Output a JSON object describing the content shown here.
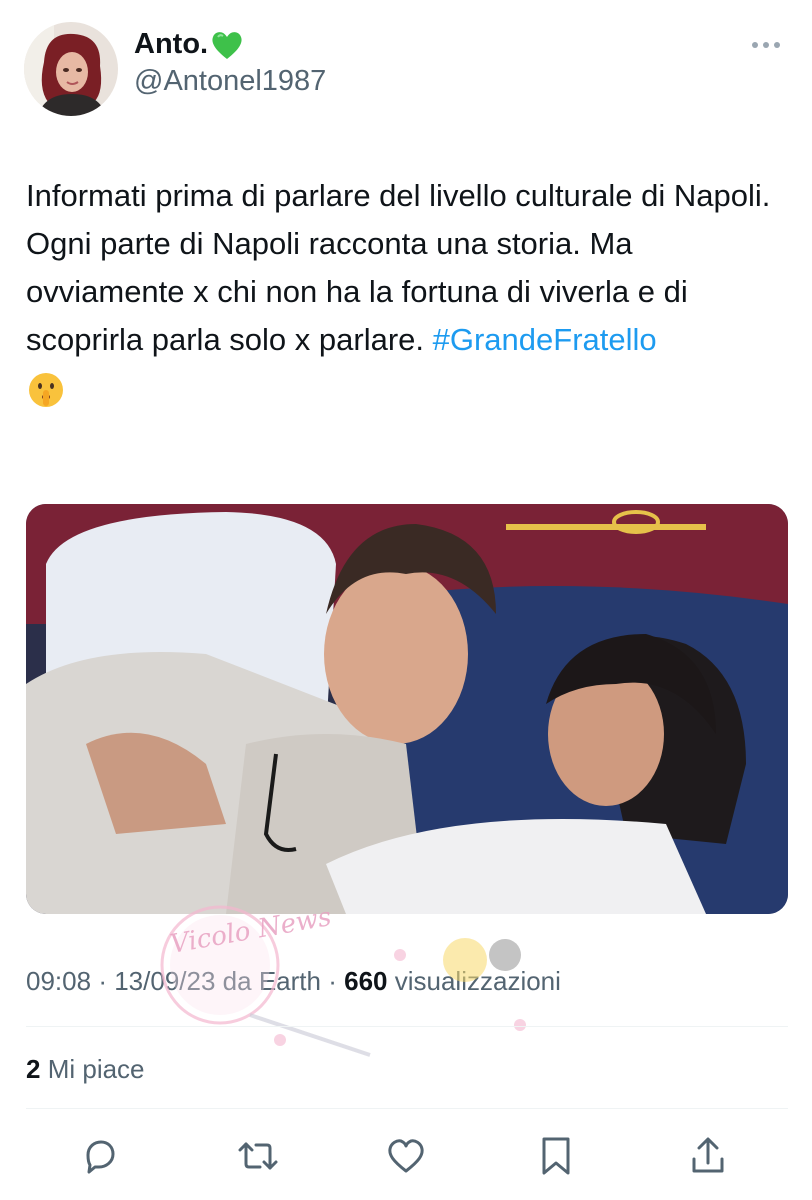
{
  "author": {
    "display_name": "Anto.",
    "badge_emoji": "green-heart",
    "handle": "@Antonel1987"
  },
  "tweet": {
    "line1": "Informati prima di parlare del livello culturale di Napoli.",
    "line2": "Ogni parte di Napoli racconta una storia. Ma ovviamente x chi non ha la fortuna di viverla e di scoprirla parla solo x parlare. ",
    "hashtag": "#GrandeFratello",
    "trailing_emoji": "shushing-face"
  },
  "meta": {
    "time": "09:08",
    "date": "13/09/23",
    "source": "da Earth",
    "views_count": "660",
    "views_label": "visualizzazioni",
    "separator": "·"
  },
  "engagement": {
    "likes_count": "2",
    "likes_label": "Mi piace"
  },
  "colors": {
    "link": "#1d9bf0",
    "secondary_text": "#536471",
    "primary_text": "#0f1419",
    "divider": "#eff3f4"
  },
  "watermark_text": "Vicolo News"
}
